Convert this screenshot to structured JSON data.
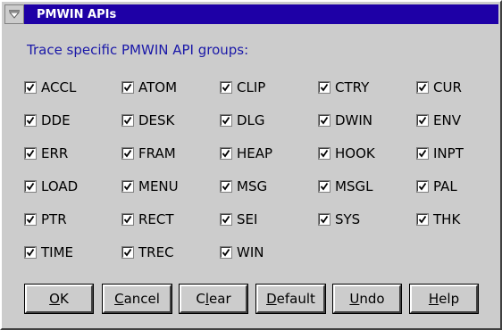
{
  "window": {
    "title": "PMWIN APIs"
  },
  "heading": "Trace specific PMWIN API groups:",
  "groups": [
    {
      "label": "ACCL",
      "checked": true
    },
    {
      "label": "ATOM",
      "checked": true
    },
    {
      "label": "CLIP",
      "checked": true
    },
    {
      "label": "CTRY",
      "checked": true
    },
    {
      "label": "CUR",
      "checked": true
    },
    {
      "label": "DDE",
      "checked": true
    },
    {
      "label": "DESK",
      "checked": true
    },
    {
      "label": "DLG",
      "checked": true
    },
    {
      "label": "DWIN",
      "checked": true
    },
    {
      "label": "ENV",
      "checked": true
    },
    {
      "label": "ERR",
      "checked": true
    },
    {
      "label": "FRAM",
      "checked": true
    },
    {
      "label": "HEAP",
      "checked": true
    },
    {
      "label": "HOOK",
      "checked": true
    },
    {
      "label": "INPT",
      "checked": true
    },
    {
      "label": "LOAD",
      "checked": true
    },
    {
      "label": "MENU",
      "checked": true
    },
    {
      "label": "MSG",
      "checked": true
    },
    {
      "label": "MSGL",
      "checked": true
    },
    {
      "label": "PAL",
      "checked": true
    },
    {
      "label": "PTR",
      "checked": true
    },
    {
      "label": "RECT",
      "checked": true
    },
    {
      "label": "SEI",
      "checked": true
    },
    {
      "label": "SYS",
      "checked": true
    },
    {
      "label": "THK",
      "checked": true
    },
    {
      "label": "TIME",
      "checked": true
    },
    {
      "label": "TREC",
      "checked": true
    },
    {
      "label": "WIN",
      "checked": true
    }
  ],
  "buttons": {
    "ok": {
      "mnemonic": "O",
      "rest": "K"
    },
    "cancel": {
      "mnemonic": "C",
      "rest": "ancel"
    },
    "clear": {
      "pre": "C",
      "mnemonic": "l",
      "rest": "ear"
    },
    "default": {
      "mnemonic": "D",
      "rest": "efault"
    },
    "undo": {
      "mnemonic": "U",
      "rest": "ndo"
    },
    "help": {
      "mnemonic": "H",
      "rest": "elp"
    }
  },
  "colors": {
    "titlebar": "#1e00a6",
    "heading": "#1a18a8",
    "face": "#cccccc"
  }
}
